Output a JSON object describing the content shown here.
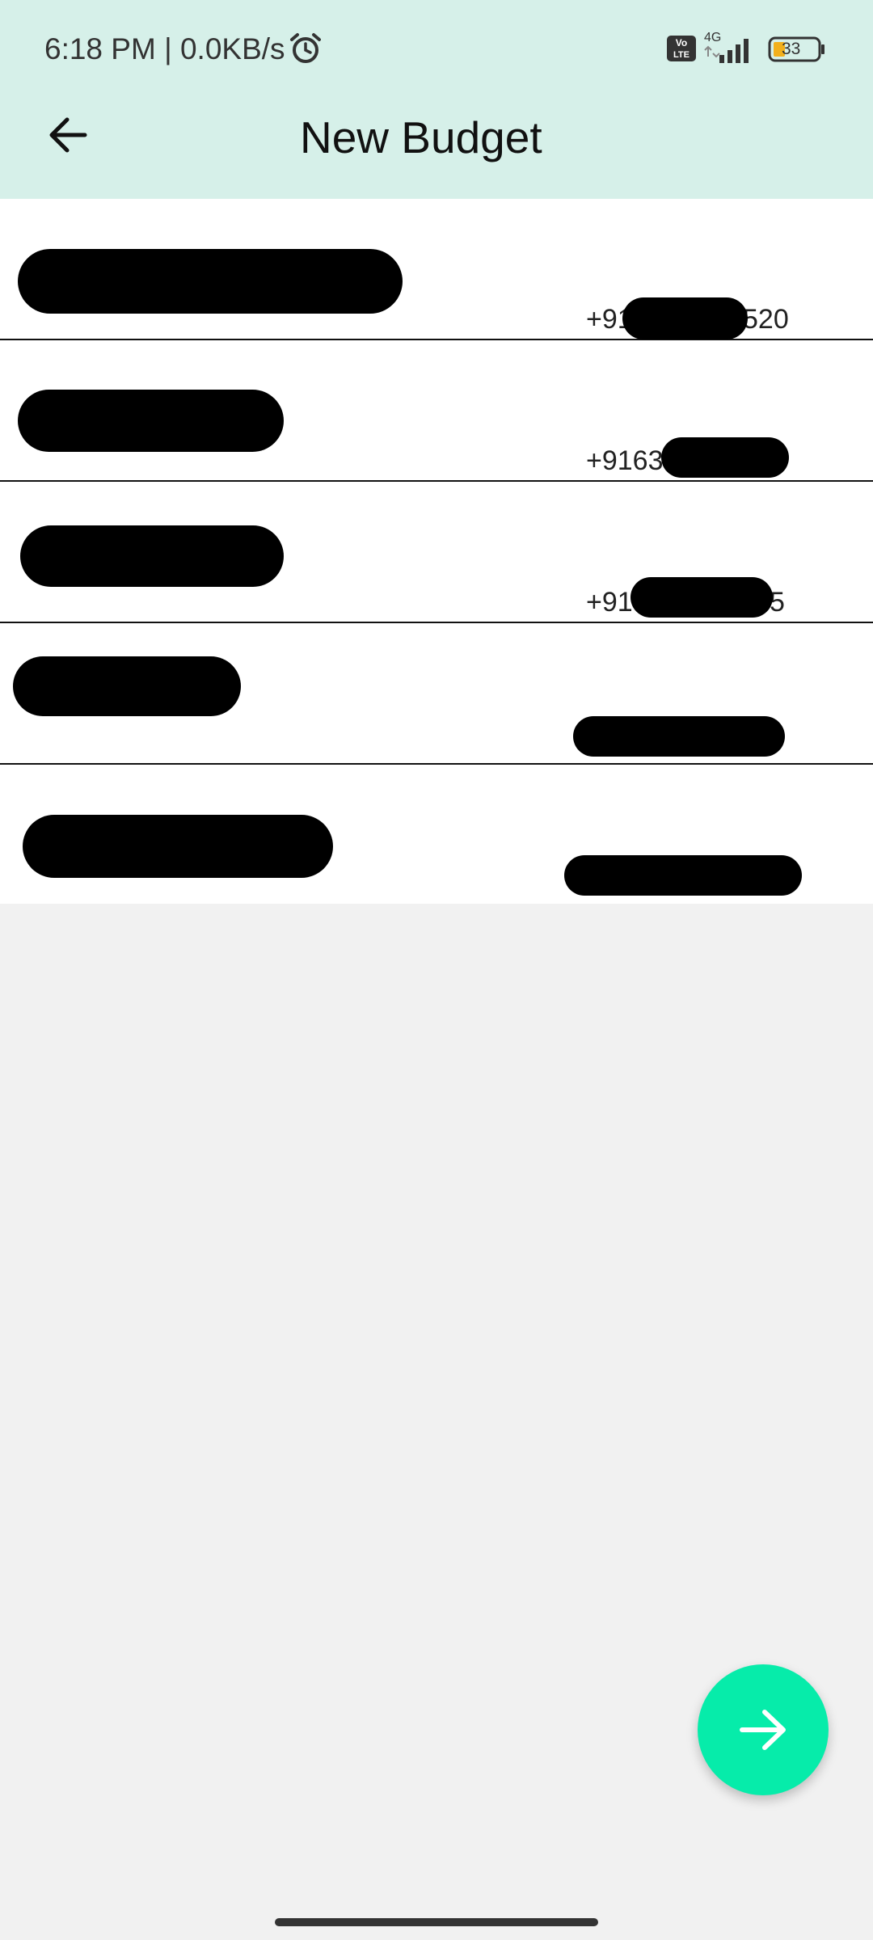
{
  "status_bar": {
    "time": "6:18 PM | 0.0KB/s",
    "network_type": "4G",
    "volte_label": "Vo LTE",
    "battery_level": "33"
  },
  "header": {
    "title": "New Budget",
    "back_icon": "arrow-left-icon"
  },
  "contacts": [
    {
      "name": "",
      "phone": "+91",
      "phone_tail": "520"
    },
    {
      "name": "",
      "phone": "+9163",
      "phone_tail": ""
    },
    {
      "name": "",
      "phone": "+91",
      "phone_tail": "5"
    },
    {
      "name": "",
      "phone": "",
      "phone_tail": ""
    },
    {
      "name": "",
      "phone": "",
      "phone_tail": ""
    }
  ],
  "fab": {
    "icon": "arrow-right-icon"
  },
  "colors": {
    "header_bg": "#d6f0e9",
    "fab_bg": "#06ecaa",
    "page_bg": "#f1f1f1"
  }
}
